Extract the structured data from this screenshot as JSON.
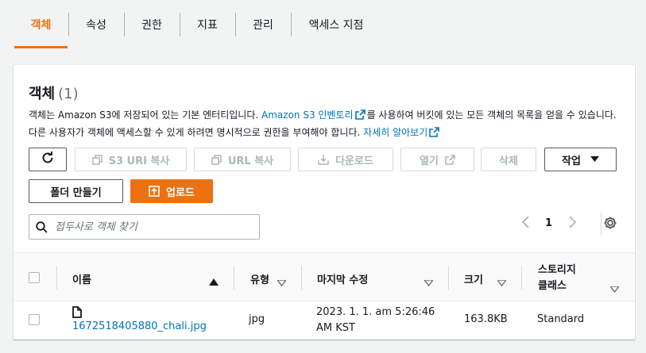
{
  "tabs": [
    {
      "label": "객체",
      "active": true
    },
    {
      "label": "속성"
    },
    {
      "label": "권한"
    },
    {
      "label": "지표"
    },
    {
      "label": "관리"
    },
    {
      "label": "액세스 지점"
    }
  ],
  "panel": {
    "title": "객체",
    "count": "(1)",
    "desc_part1": "객체는 Amazon S3에 저장되어 있는 기본 엔터티입니다.",
    "desc_link1": "Amazon S3 인벤토리",
    "desc_part2": "를 사용하여 버킷에 있는 모든 객체의 목록을 얻을 수 있습니다. 다른 사용자가 객체에 액세스할 수 있게 하려면 명시적으로 권한을 부여해야 합니다.",
    "desc_link2": "자세히 알아보기"
  },
  "actions": {
    "refresh_icon": "refresh-icon",
    "copy_s3_uri": "S3 URI 복사",
    "copy_url": "URL 복사",
    "download": "다운로드",
    "open": "열기",
    "delete": "삭제",
    "actions_menu": "작업",
    "create_folder": "폴더 만들기",
    "upload": "업로드"
  },
  "search": {
    "placeholder": "접두사로 객체 찾기",
    "value": ""
  },
  "pagination": {
    "current_page": "1"
  },
  "table": {
    "columns": {
      "name": "이름",
      "type": "유형",
      "last_modified": "마지막 수정",
      "size": "크기",
      "storage_class_line1": "스토리지",
      "storage_class_line2": "클래스"
    },
    "rows": [
      {
        "name": "1672518405880_chali.jpg",
        "type": "jpg",
        "last_modified_line1": "2023. 1. 1. am 5:26:46",
        "last_modified_line2": "AM KST",
        "size": "163.8KB",
        "storage_class": "Standard"
      }
    ]
  },
  "colors": {
    "accent": "#ec7211",
    "link": "#0073bb",
    "disabled": "#aab7b8"
  }
}
